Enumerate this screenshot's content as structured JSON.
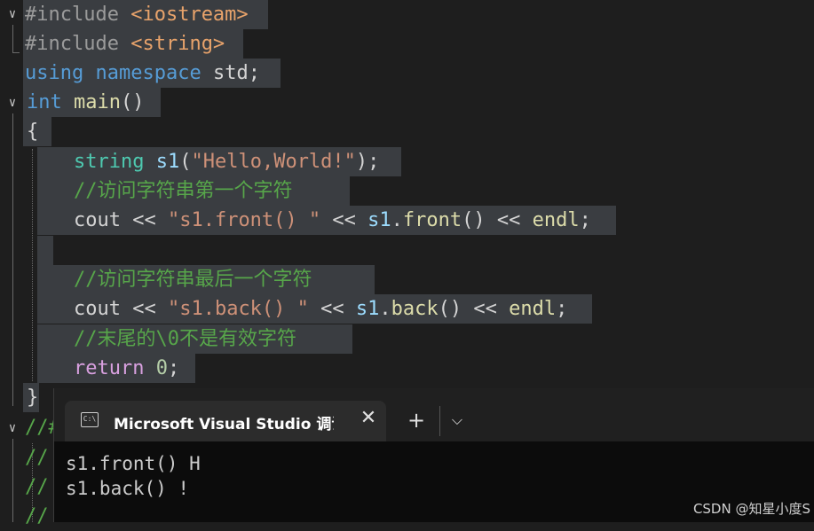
{
  "code": {
    "l1": {
      "hash": "#include",
      "target": "<iostream>"
    },
    "l2": {
      "hash": "#include",
      "target": "<string>"
    },
    "l3": {
      "kw1": "using",
      "kw2": "namespace",
      "name": "std;"
    },
    "l4": {
      "type": "int",
      "fn": "main",
      "rest": "()"
    },
    "l5": {
      "text": "{"
    },
    "l6": {
      "type": "string",
      "var": "s1",
      "open": "(",
      "str": "\"Hello,World!\"",
      "close": ");"
    },
    "l7": {
      "comment": "//访问字符串第一个字符"
    },
    "l8": {
      "cout": "cout",
      "op1": " << ",
      "str": "\"s1.front() \"",
      "op2": " << ",
      "var": "s1",
      "dot": ".",
      "fn": "front",
      "paren": "()",
      "op3": " << ",
      "endl": "endl",
      "semi": ";"
    },
    "l10": {
      "comment": "//访问字符串最后一个字符"
    },
    "l11": {
      "cout": "cout",
      "op1": " << ",
      "str": "\"s1.back() \"",
      "op2": " << ",
      "var": "s1",
      "dot": ".",
      "fn": "back",
      "paren": "()",
      "op3": " << ",
      "endl": "endl",
      "semi": ";"
    },
    "l12": {
      "comment": "//末尾的\\0不是有效字符"
    },
    "l13": {
      "kw": "return",
      "num": "0",
      "semi": ";"
    },
    "l14": {
      "text": "}"
    },
    "l15": {
      "text": "//#"
    },
    "l16": {
      "text": "//"
    },
    "l17": {
      "text": "//"
    },
    "l18": {
      "text": "//"
    }
  },
  "terminal": {
    "tab_title": "Microsoft Visual Studio 调试控制台",
    "tab_icon": "C:\\",
    "close_glyph": "✕",
    "new_tab_glyph": "+",
    "dropdown_glyph": "⌵",
    "output": [
      "s1.front() H",
      "s1.back() !"
    ]
  },
  "watermark": "CSDN @知星小度S",
  "colors": {
    "background": "#1e1e1e",
    "selection": "#3a3d41",
    "keyword": "#569cd6",
    "type": "#4ec9b0",
    "string": "#ce9178",
    "comment": "#57a64a",
    "terminal_bg": "#0c0c0c"
  }
}
